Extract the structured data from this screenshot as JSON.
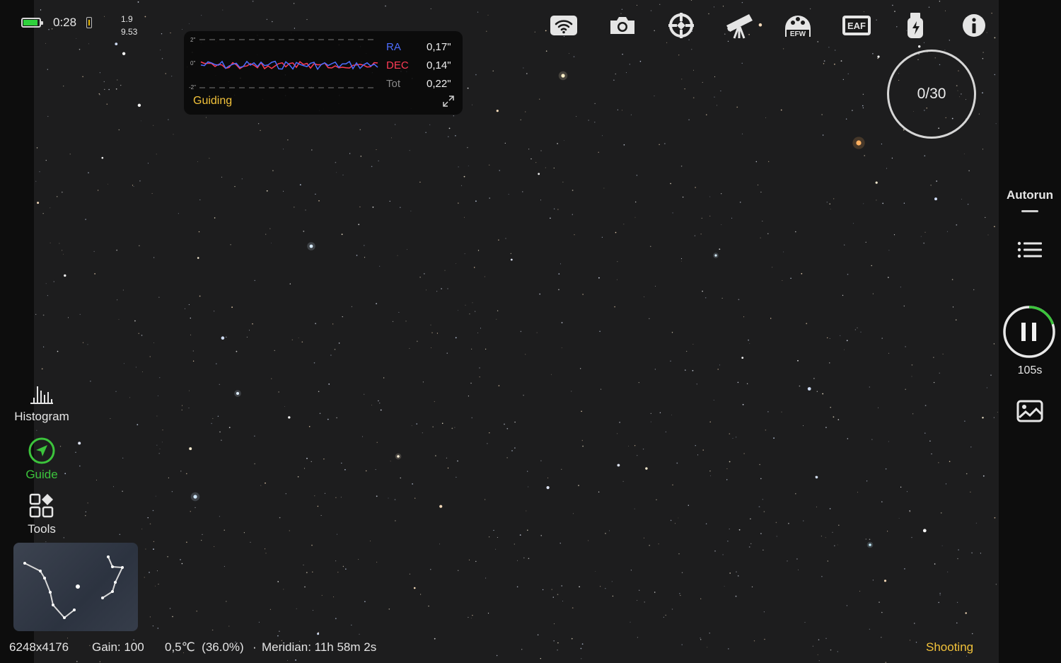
{
  "status": {
    "time": "0:28",
    "battery_level": 0.9,
    "value_top": "1.9",
    "value_bottom": "9.53"
  },
  "guide_panel": {
    "scale_top": "2\"",
    "scale_mid": "0\"",
    "scale_bottom": "-2\"",
    "ra_label": "RA",
    "ra_value": "0,17\"",
    "dec_label": "DEC",
    "dec_value": "0,14\"",
    "tot_label": "Tot",
    "tot_value": "0,22\"",
    "status": "Guiding",
    "ra_color": "#4d6dff",
    "dec_color": "#ff3b55"
  },
  "toolbar": {
    "icons": [
      "wifi-icon",
      "camera-icon",
      "guide-scope-icon",
      "telescope-icon",
      "efw-icon",
      "eaf-icon",
      "usb-power-icon",
      "info-icon"
    ],
    "efw_label": "EFW",
    "eaf_label": "EAF"
  },
  "capture": {
    "counter": "0/30",
    "autorun_label": "Autorun",
    "exposure_remaining": "105s",
    "progress": 0.2
  },
  "tools": {
    "histogram": "Histogram",
    "guide": "Guide",
    "tools": "Tools"
  },
  "bottom": {
    "resolution": "6248x4176",
    "gain": "Gain: 100",
    "temperature": "0,5℃  (36.0%)",
    "meridian": "Meridian: 11h 58m 2s",
    "state": "Shooting"
  },
  "colors": {
    "accent_green": "#3cc43c",
    "accent_yellow": "#f2c23a",
    "panel_bg": "#080808"
  }
}
